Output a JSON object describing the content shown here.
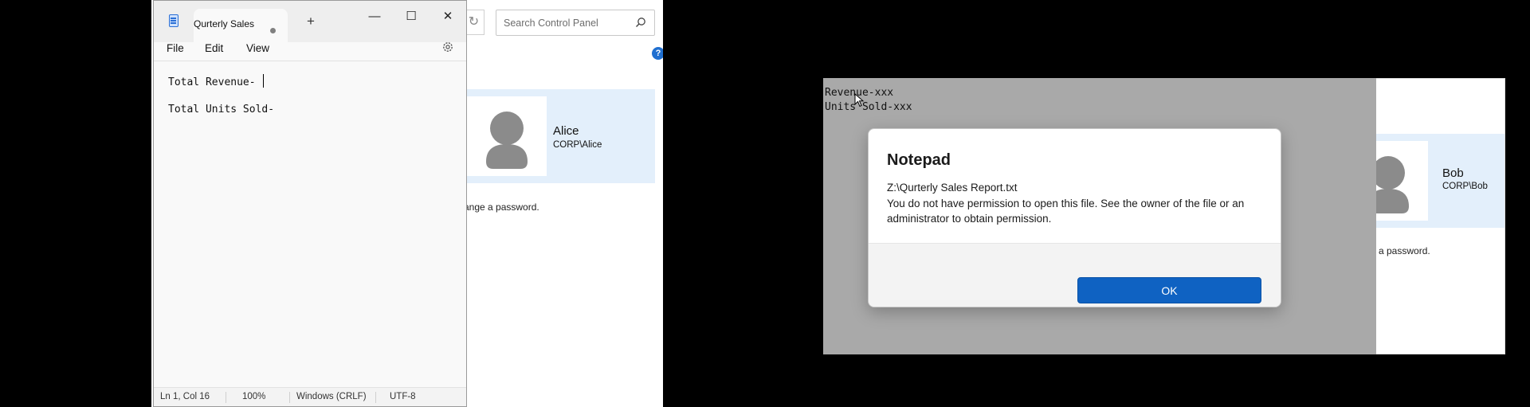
{
  "control_panel_left": {
    "search_placeholder": "Search Control Panel",
    "help_label": "?",
    "user_name": "Alice",
    "user_account": "CORP\\Alice",
    "password_text": "ange a password.",
    "icons": [
      "refresh-icon",
      "search-icon",
      "help-icon",
      "user-avatar-icon"
    ]
  },
  "notepad": {
    "tab_title": "Qurterly Sales",
    "new_tab_label": "+",
    "window_buttons": {
      "minimize": "—",
      "maximize": "☐",
      "close": "✕"
    },
    "menu": [
      "File",
      "Edit",
      "View"
    ],
    "lines": [
      "Total Revenue- ",
      "Total Units Sold-"
    ],
    "status": {
      "position": "Ln 1, Col 16",
      "zoom": "100%",
      "line_ending": "Windows (CRLF)",
      "encoding": "UTF-8"
    },
    "icons": [
      "notepad-icon",
      "unsaved-dot-icon",
      "settings-gear-icon"
    ]
  },
  "background_notepad_text": {
    "line1": "Revenue-xxx",
    "line2": "Units Sold-xxx"
  },
  "dialog": {
    "title": "Notepad",
    "path": "Z:\\Qurterly Sales Report.txt",
    "message": "You do not have permission to open this file.  See the owner of the file or an administrator to obtain permission.",
    "ok_label": "OK",
    "accent_color": "#0f62c2"
  },
  "control_panel_right": {
    "user_name": "Bob",
    "user_account": "CORP\\Bob",
    "password_text": "a password."
  }
}
